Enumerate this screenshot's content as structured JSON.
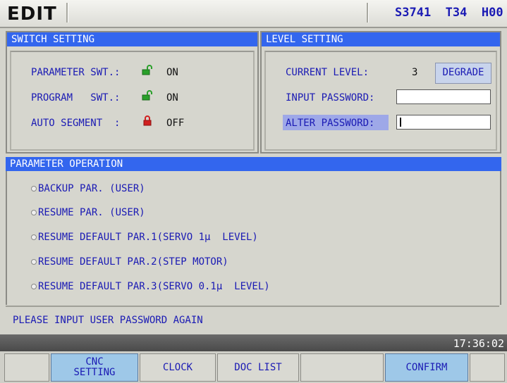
{
  "header": {
    "mode": "EDIT",
    "status": "S3741  T34  H00",
    "status_parts": {
      "s": "S3741",
      "t": "T34",
      "h": "H00"
    }
  },
  "switch_setting": {
    "title": "SWITCH SETTING",
    "items": [
      {
        "label": "PARAMETER SWT.:",
        "value": "ON",
        "icon": "unlock-icon",
        "icon_color": "#2aa02a"
      },
      {
        "label": "PROGRAM   SWT.:",
        "value": "ON",
        "icon": "unlock-icon",
        "icon_color": "#2aa02a"
      },
      {
        "label": "AUTO SEGMENT  :",
        "value": "OFF",
        "icon": "lock-icon",
        "icon_color": "#d02020"
      }
    ]
  },
  "level_setting": {
    "title": "LEVEL SETTING",
    "current_level_label": "CURRENT LEVEL:",
    "current_level_value": "3",
    "degrade_label": "DEGRADE",
    "input_password_label": "INPUT PASSWORD:",
    "input_password_value": "",
    "alter_password_label": "ALTER PASSWORD:",
    "alter_password_value": ""
  },
  "parameter_operation": {
    "title": "PARAMETER OPERATION",
    "options": [
      "BACKUP PAR. (USER)",
      "RESUME PAR. (USER)",
      "RESUME DEFAULT PAR.1(SERVO 1μ  LEVEL)",
      "RESUME DEFAULT PAR.2(STEP MOTOR)",
      "RESUME DEFAULT PAR.3(SERVO 0.1μ  LEVEL)"
    ]
  },
  "message": "PLEASE INPUT USER PASSWORD AGAIN",
  "time": "17:36:02",
  "softkeys": {
    "key0": "",
    "key1_line1": "CNC",
    "key1_line2": "SETTING",
    "key2": "CLOCK",
    "key3": "DOC LIST",
    "key4": "",
    "key5": "CONFIRM",
    "key6": ""
  },
  "colors": {
    "title_bar": "#3366ee",
    "text_blue": "#1a1ab4",
    "highlight": "#9ea8e8",
    "active_key": "#9ec8e8"
  }
}
